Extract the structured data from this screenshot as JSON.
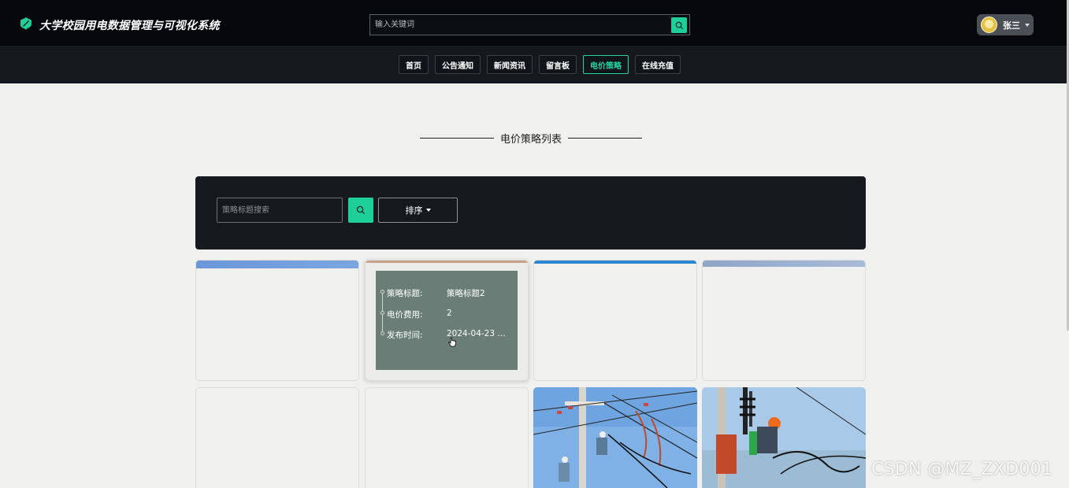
{
  "header": {
    "title": "大学校园用电数据管理与可视化系统",
    "search_placeholder": "输入关键词",
    "user_name": "张三"
  },
  "nav": {
    "items": [
      {
        "label": "首页"
      },
      {
        "label": "公告通知"
      },
      {
        "label": "新闻资讯"
      },
      {
        "label": "留言板"
      },
      {
        "label": "电价策略"
      },
      {
        "label": "在线充值"
      }
    ],
    "active": "电价策略"
  },
  "page": {
    "section_title": "电价策略列表"
  },
  "filter": {
    "search_placeholder": "策略标题搜索",
    "sort_label": "排序"
  },
  "card_hover": {
    "title_label": "策略标题:",
    "title_value": "策略标题2",
    "price_label": "电价费用:",
    "price_value": "2",
    "time_label": "发布时间:",
    "time_value": "2024-04-23 1..."
  },
  "colors": {
    "accent": "#1fcf9a",
    "header_bg": "#06080c",
    "nav_bg": "#15191e",
    "overlay_bg": "#6a7d77"
  },
  "watermark": "CSDN @MZ_ZXD001"
}
